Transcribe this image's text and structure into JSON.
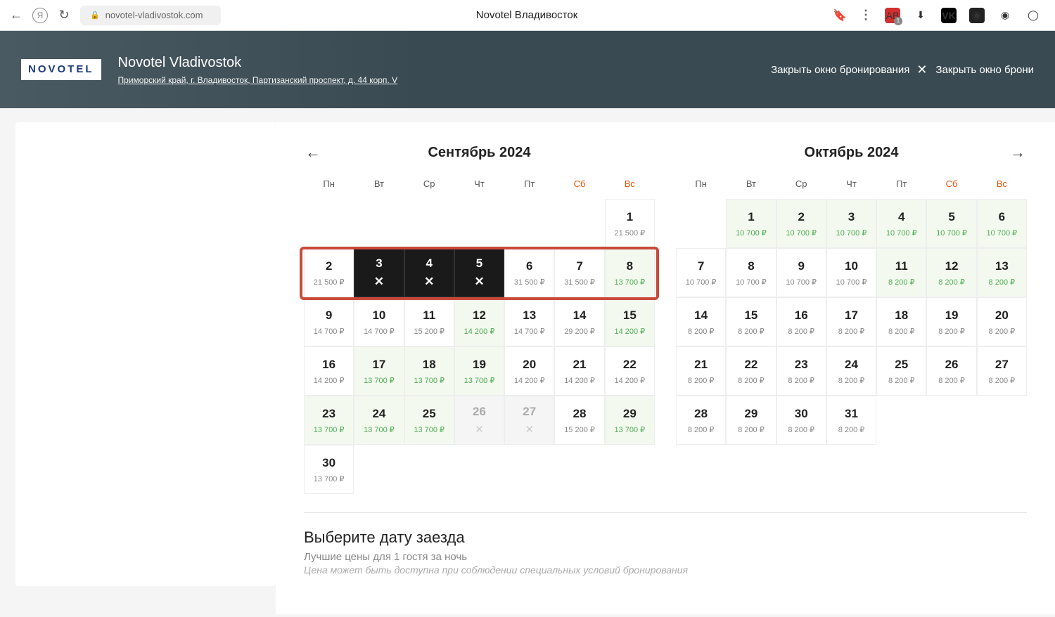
{
  "browser": {
    "url_host": "novotel-vladivostok.com",
    "tab_title": "Novotel Владивосток",
    "ext_badge": "1"
  },
  "hero": {
    "logo": "NOVOTEL",
    "hotel_name": "Novotel Vladivostok",
    "address": "Приморский край, г. Владивосток, Партизанский проспект, д. 44 корп. V",
    "close_label": "Закрыть окно бронирования",
    "close_label2": "Закрыть окно брони"
  },
  "calendar": {
    "month1_title": "Сентябрь 2024",
    "month2_title": "Октябрь 2024",
    "weekdays": [
      "Пн",
      "Вт",
      "Ср",
      "Чт",
      "Пт",
      "Сб",
      "Вс"
    ],
    "sept": [
      null,
      null,
      null,
      null,
      null,
      null,
      {
        "d": "1",
        "p": "21 500 ₽"
      },
      {
        "d": "2",
        "p": "21 500 ₽"
      },
      {
        "d": "3",
        "black": true
      },
      {
        "d": "4",
        "black": true
      },
      {
        "d": "5",
        "black": true
      },
      {
        "d": "6",
        "p": "31 500 ₽"
      },
      {
        "d": "7",
        "p": "31 500 ₽"
      },
      {
        "d": "8",
        "p": "13 700 ₽",
        "green": true,
        "bg": true
      },
      {
        "d": "9",
        "p": "14 700 ₽"
      },
      {
        "d": "10",
        "p": "14 700 ₽"
      },
      {
        "d": "11",
        "p": "15 200 ₽"
      },
      {
        "d": "12",
        "p": "14 200 ₽",
        "green": true,
        "bg": true
      },
      {
        "d": "13",
        "p": "14 700 ₽"
      },
      {
        "d": "14",
        "p": "29 200 ₽"
      },
      {
        "d": "15",
        "p": "14 200 ₽",
        "green": true,
        "bg": true
      },
      {
        "d": "16",
        "p": "14 200 ₽"
      },
      {
        "d": "17",
        "p": "13 700 ₽",
        "green": true,
        "bg": true
      },
      {
        "d": "18",
        "p": "13 700 ₽",
        "green": true,
        "bg": true
      },
      {
        "d": "19",
        "p": "13 700 ₽",
        "green": true,
        "bg": true
      },
      {
        "d": "20",
        "p": "14 200 ₽"
      },
      {
        "d": "21",
        "p": "14 200 ₽"
      },
      {
        "d": "22",
        "p": "14 200 ₽"
      },
      {
        "d": "23",
        "p": "13 700 ₽",
        "green": true,
        "bg": true
      },
      {
        "d": "24",
        "p": "13 700 ₽",
        "green": true,
        "bg": true
      },
      {
        "d": "25",
        "p": "13 700 ₽",
        "green": true,
        "bg": true
      },
      {
        "d": "26",
        "disabled": true
      },
      {
        "d": "27",
        "disabled": true
      },
      {
        "d": "28",
        "p": "15 200 ₽"
      },
      {
        "d": "29",
        "p": "13 700 ₽",
        "green": true,
        "bg": true
      },
      {
        "d": "30",
        "p": "13 700 ₽"
      }
    ],
    "oct": [
      {
        "d": "1",
        "p": "10 700 ₽",
        "green": true,
        "bg": true
      },
      {
        "d": "2",
        "p": "10 700 ₽",
        "green": true,
        "bg": true
      },
      {
        "d": "3",
        "p": "10 700 ₽",
        "green": true,
        "bg": true
      },
      {
        "d": "4",
        "p": "10 700 ₽",
        "green": true,
        "bg": true
      },
      {
        "d": "5",
        "p": "10 700 ₽",
        "green": true,
        "bg": true
      },
      {
        "d": "6",
        "p": "10 700 ₽",
        "green": true,
        "bg": true
      },
      {
        "d": "7",
        "p": "10 700 ₽"
      },
      {
        "d": "8",
        "p": "10 700 ₽"
      },
      {
        "d": "9",
        "p": "10 700 ₽"
      },
      {
        "d": "10",
        "p": "10 700 ₽"
      },
      {
        "d": "11",
        "p": "8 200 ₽",
        "green": true,
        "bg": true
      },
      {
        "d": "12",
        "p": "8 200 ₽",
        "green": true,
        "bg": true
      },
      {
        "d": "13",
        "p": "8 200 ₽",
        "green": true,
        "bg": true
      },
      {
        "d": "14",
        "p": "8 200 ₽"
      },
      {
        "d": "15",
        "p": "8 200 ₽"
      },
      {
        "d": "16",
        "p": "8 200 ₽"
      },
      {
        "d": "17",
        "p": "8 200 ₽"
      },
      {
        "d": "18",
        "p": "8 200 ₽"
      },
      {
        "d": "19",
        "p": "8 200 ₽"
      },
      {
        "d": "20",
        "p": "8 200 ₽"
      },
      {
        "d": "21",
        "p": "8 200 ₽"
      },
      {
        "d": "22",
        "p": "8 200 ₽"
      },
      {
        "d": "23",
        "p": "8 200 ₽"
      },
      {
        "d": "24",
        "p": "8 200 ₽"
      },
      {
        "d": "25",
        "p": "8 200 ₽"
      },
      {
        "d": "26",
        "p": "8 200 ₽"
      },
      {
        "d": "27",
        "p": "8 200 ₽"
      },
      {
        "d": "28",
        "p": "8 200 ₽"
      },
      {
        "d": "29",
        "p": "8 200 ₽"
      },
      {
        "d": "30",
        "p": "8 200 ₽"
      },
      {
        "d": "31",
        "p": "8 200 ₽"
      }
    ]
  },
  "footer": {
    "title": "Выберите дату заезда",
    "sub1": "Лучшие цены для 1 гостя за ночь",
    "sub2": "Цена может быть доступна при соблюдении специальных условий бронирования"
  }
}
